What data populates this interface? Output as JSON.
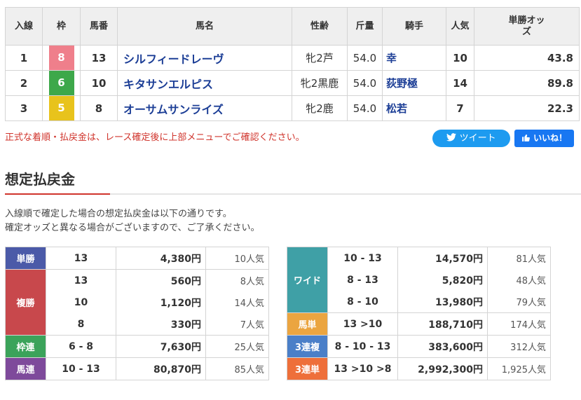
{
  "headers": {
    "rank": "入線",
    "frame": "枠",
    "number": "馬番",
    "horse": "馬名",
    "sexage": "性齢",
    "weight": "斤量",
    "jockey": "騎手",
    "popularity": "人気",
    "odds": "単勝オッズ"
  },
  "rows": [
    {
      "rank": "1",
      "frame": "8",
      "frame_color": "#ef7f8b",
      "number": "13",
      "horse": "シルフィードレーヴ",
      "sexage": "牝2芦",
      "weight": "54.0",
      "jockey": "幸",
      "popularity": "10",
      "odds": "43.8"
    },
    {
      "rank": "2",
      "frame": "6",
      "frame_color": "#3da84a",
      "number": "10",
      "horse": "キタサンエルピス",
      "sexage": "牝2黒鹿",
      "weight": "54.0",
      "jockey": "荻野極",
      "popularity": "14",
      "odds": "89.8"
    },
    {
      "rank": "3",
      "frame": "5",
      "frame_color": "#e8c31c",
      "number": "8",
      "horse": "オーサムサンライズ",
      "sexage": "牝2鹿",
      "weight": "54.0",
      "jockey": "松若",
      "popularity": "7",
      "odds": "22.3"
    }
  ],
  "notice": "正式な着順・払戻金は、レース確定後に上部メニューでご確認ください。",
  "tweet_label": "ツイート",
  "like_label": "いいね！",
  "section_title": "想定払戻金",
  "intro_line1": "入線順で確定した場合の想定払戻金は以下の通りです。",
  "intro_line2": "確定オッズと異なる場合がございますので、ご了承ください。",
  "payouts_left": {
    "tansho": {
      "label": "単勝",
      "color": "#4b5aa8",
      "entries": [
        {
          "num": "13",
          "yen": "4,380円",
          "pop": "10人気"
        }
      ]
    },
    "fukusho": {
      "label": "複勝",
      "color": "#c8484c",
      "entries": [
        {
          "num": "13",
          "yen": "560円",
          "pop": "8人気"
        },
        {
          "num": "10",
          "yen": "1,120円",
          "pop": "14人気"
        },
        {
          "num": "8",
          "yen": "330円",
          "pop": "7人気"
        }
      ]
    },
    "wakuren": {
      "label": "枠連",
      "color": "#3ba35a",
      "entries": [
        {
          "num": "6 - 8",
          "yen": "7,630円",
          "pop": "25人気"
        }
      ]
    },
    "umaren": {
      "label": "馬連",
      "color": "#7e4a9b",
      "entries": [
        {
          "num": "10 - 13",
          "yen": "80,870円",
          "pop": "85人気"
        }
      ]
    }
  },
  "payouts_right": {
    "wide": {
      "label": "ワイド",
      "color": "#3fa0a6",
      "entries": [
        {
          "num": "10 - 13",
          "yen": "14,570円",
          "pop": "81人気"
        },
        {
          "num": "8 - 13",
          "yen": "5,820円",
          "pop": "48人気"
        },
        {
          "num": "8 - 10",
          "yen": "13,980円",
          "pop": "79人気"
        }
      ]
    },
    "umatan": {
      "label": "馬単",
      "color": "#eba540",
      "entries": [
        {
          "num": "13 >10",
          "yen": "188,710円",
          "pop": "174人気"
        }
      ]
    },
    "sanrenpuku": {
      "label": "3連複",
      "color": "#4a7fc8",
      "entries": [
        {
          "num": "8 - 10 - 13",
          "yen": "383,600円",
          "pop": "312人気"
        }
      ]
    },
    "sanrentan": {
      "label": "3連単",
      "color": "#ee6f3a",
      "entries": [
        {
          "num": "13 >10 >8",
          "yen": "2,992,300円",
          "pop": "1,925人気"
        }
      ]
    }
  }
}
